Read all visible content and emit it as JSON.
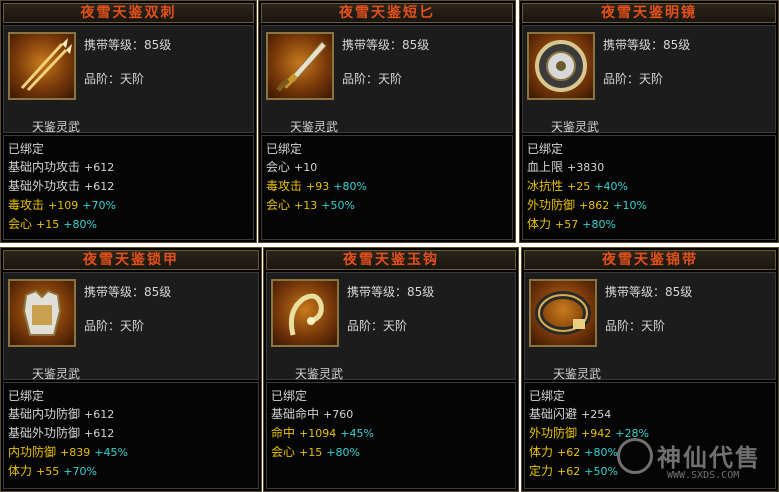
{
  "level_label": "携带等级：85级",
  "grade_label": "品阶：天阶",
  "set_name": "天鉴灵武",
  "bound_label": "已绑定",
  "items": [
    {
      "title": "夜雪天鉴双刺",
      "icon": "dual-spike-icon",
      "stats": [
        {
          "name": "基础内功攻击",
          "base": "+612",
          "pct": "",
          "yellow": false
        },
        {
          "name": "基础外功攻击",
          "base": "+612",
          "pct": "",
          "yellow": false
        },
        {
          "name": "毒攻击",
          "base": "+109",
          "pct": "+70%",
          "yellow": true
        },
        {
          "name": "会心",
          "base": "+15",
          "pct": "+80%",
          "yellow": true
        }
      ]
    },
    {
      "title": "夜雪天鉴短匕",
      "icon": "dagger-icon",
      "stats": [
        {
          "name": "会心",
          "base": "+10",
          "pct": "",
          "yellow": false
        },
        {
          "name": "毒攻击",
          "base": "+93",
          "pct": "+80%",
          "yellow": true
        },
        {
          "name": "会心",
          "base": "+13",
          "pct": "+50%",
          "yellow": true
        }
      ]
    },
    {
      "title": "夜雪天鉴明镜",
      "icon": "mirror-icon",
      "stats": [
        {
          "name": "血上限",
          "base": "+3830",
          "pct": "",
          "yellow": false
        },
        {
          "name": "冰抗性",
          "base": "+25",
          "pct": "+40%",
          "yellow": true
        },
        {
          "name": "外功防御",
          "base": "+862",
          "pct": "+10%",
          "yellow": true
        },
        {
          "name": "体力",
          "base": "+57",
          "pct": "+80%",
          "yellow": true
        }
      ]
    },
    {
      "title": "夜雪天鉴锁甲",
      "icon": "armor-icon",
      "stats": [
        {
          "name": "基础内功防御",
          "base": "+612",
          "pct": "",
          "yellow": false
        },
        {
          "name": "基础外功防御",
          "base": "+612",
          "pct": "",
          "yellow": false
        },
        {
          "name": "内功防御",
          "base": "+839",
          "pct": "+45%",
          "yellow": true
        },
        {
          "name": "体力",
          "base": "+55",
          "pct": "+70%",
          "yellow": true
        }
      ]
    },
    {
      "title": "夜雪天鉴玉钩",
      "icon": "jade-hook-icon",
      "stats": [
        {
          "name": "基础命中",
          "base": "+760",
          "pct": "",
          "yellow": false
        },
        {
          "name": "命中",
          "base": "+1094",
          "pct": "+45%",
          "yellow": true
        },
        {
          "name": "会心",
          "base": "+15",
          "pct": "+80%",
          "yellow": true
        }
      ]
    },
    {
      "title": "夜雪天鉴锦带",
      "icon": "belt-icon",
      "stats": [
        {
          "name": "基础闪避",
          "base": "+254",
          "pct": "",
          "yellow": false
        },
        {
          "name": "外功防御",
          "base": "+942",
          "pct": "+28%",
          "yellow": true
        },
        {
          "name": "体力",
          "base": "+62",
          "pct": "+80%",
          "yellow": true
        },
        {
          "name": "定力",
          "base": "+62",
          "pct": "+50%",
          "yellow": true
        }
      ]
    }
  ],
  "watermark": {
    "text": "神仙代售",
    "url": "WWW.SXDS.COM"
  }
}
